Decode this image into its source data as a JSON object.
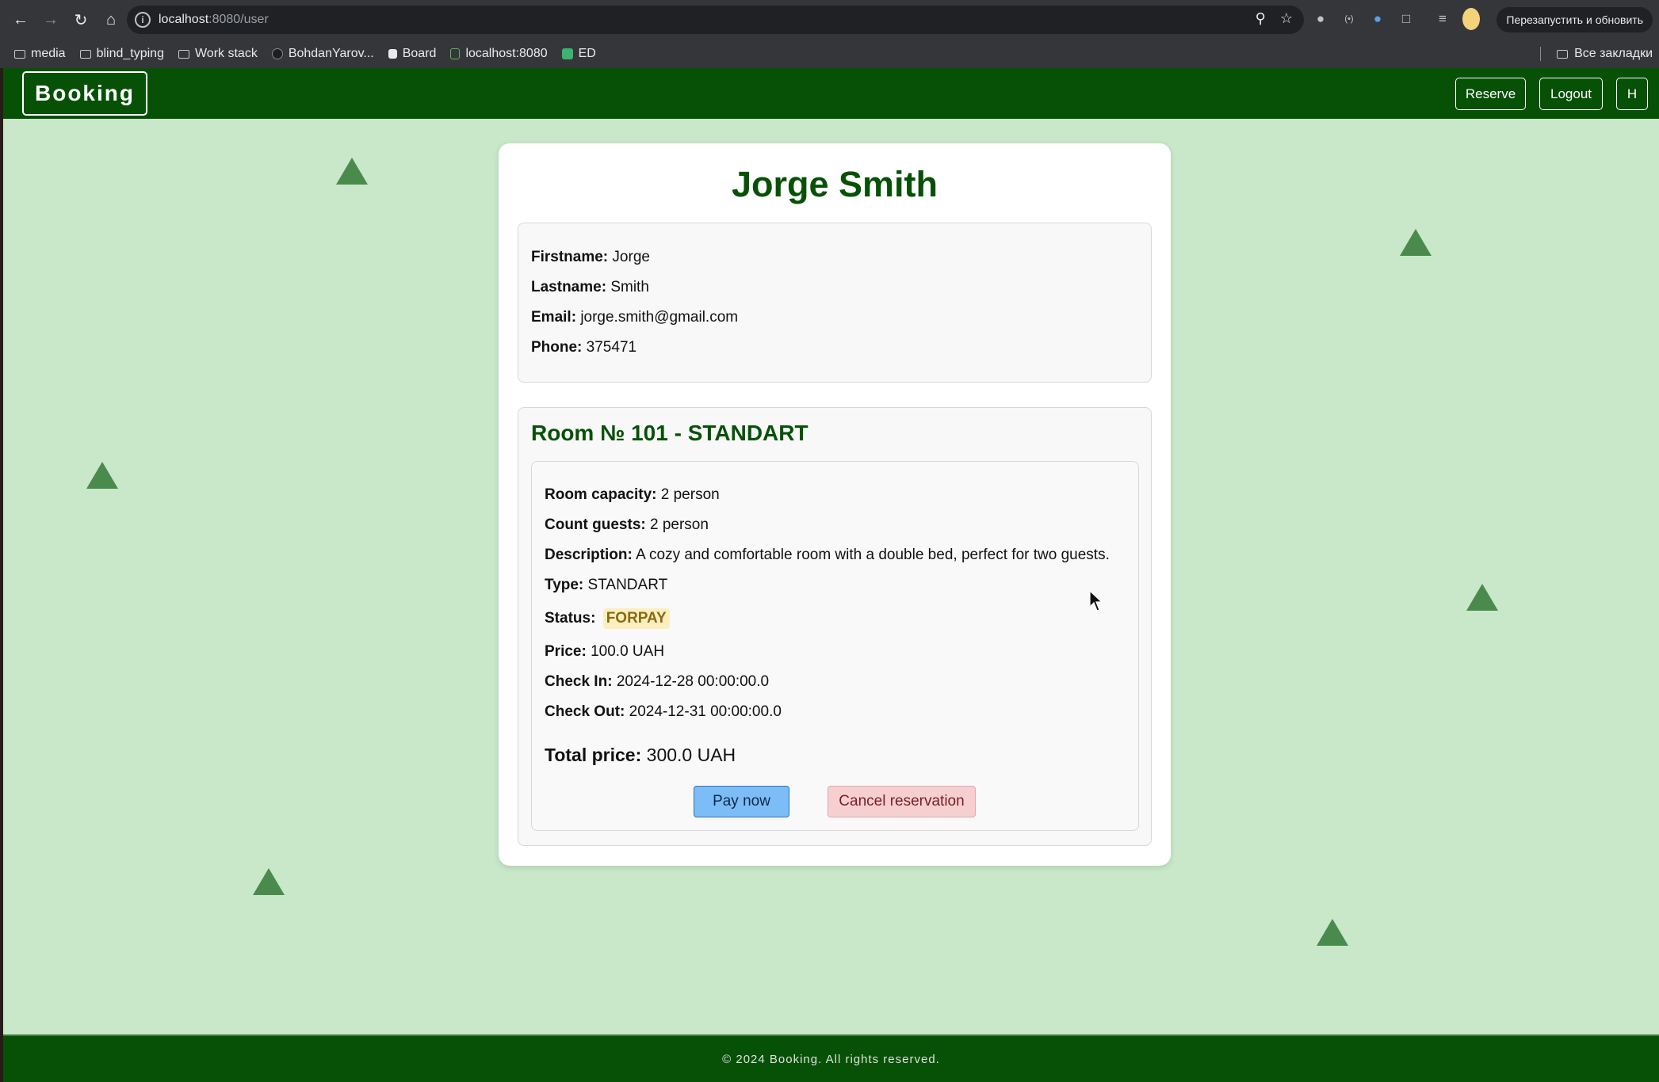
{
  "browser": {
    "url_host": "localhost",
    "url_path": ":8080/user",
    "relaunch_label": "Перезапустить и обновить",
    "bookmarks": [
      "media",
      "blind_typing",
      "Work stack",
      "BohdanYarov...",
      "Board",
      "localhost:8080",
      "ED"
    ],
    "all_bookmarks": "Все закладки"
  },
  "header": {
    "brand": "Booking",
    "reserve_label": "Reserve",
    "logout_label": "Logout",
    "profile_label": "H"
  },
  "user": {
    "full_name": "Jorge Smith",
    "firstname_label": "Firstname:",
    "firstname": "Jorge",
    "lastname_label": "Lastname:",
    "lastname": "Smith",
    "email_label": "Email:",
    "email": "jorge.smith@gmail.com",
    "phone_label": "Phone:",
    "phone": "375471"
  },
  "room": {
    "title": "Room № 101 - STANDART",
    "capacity_label": "Room capacity:",
    "capacity": "2 person",
    "guests_label": "Count guests:",
    "guests": "2 person",
    "description_label": "Description:",
    "description": "A cozy and comfortable room with a double bed, perfect for two guests.",
    "type_label": "Type:",
    "type": "STANDART",
    "status_label": "Status:",
    "status": "FORPAY",
    "price_label": "Price:",
    "price": "100.0 UAH",
    "checkin_label": "Check In:",
    "checkin": "2024-12-28 00:00:00.0",
    "checkout_label": "Check Out:",
    "checkout": "2024-12-31 00:00:00.0",
    "total_label": "Total price:",
    "total": "300.0 UAH",
    "pay_label": "Pay now",
    "cancel_label": "Cancel reservation"
  },
  "footer": {
    "text": "© 2024 Booking. All rights reserved."
  },
  "colors": {
    "header_bg": "#075107",
    "page_bg": "#c8e8c9",
    "accent_green": "#075107",
    "triangle": "#4a8b4d",
    "pay_button": "#7cbdf7",
    "cancel_button": "#f6cfd1",
    "status_badge_bg": "#fbefc0"
  }
}
